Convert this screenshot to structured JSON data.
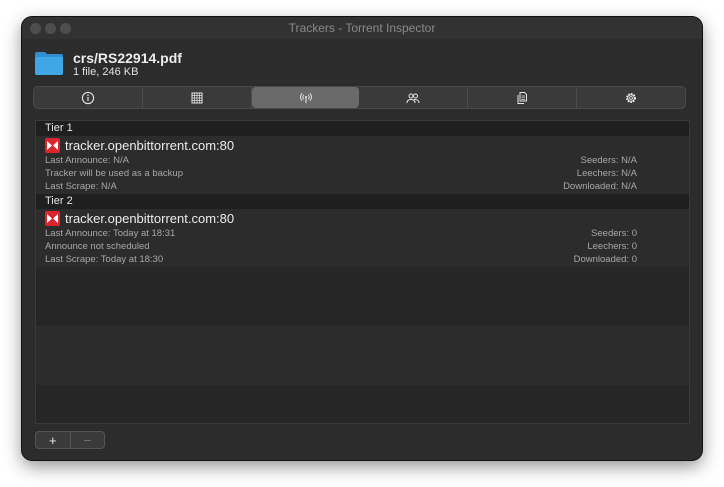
{
  "window": {
    "title": "Trackers - Torrent Inspector"
  },
  "header": {
    "name": "crs/RS22914.pdf",
    "info": "1 file, 246 KB"
  },
  "tabs": [
    {
      "icon": "info-icon",
      "active": false
    },
    {
      "icon": "grid-icon",
      "active": false
    },
    {
      "icon": "antenna-icon",
      "active": true
    },
    {
      "icon": "people-icon",
      "active": false
    },
    {
      "icon": "files-icon",
      "active": false
    },
    {
      "icon": "gear-icon",
      "active": false
    }
  ],
  "tiers": [
    {
      "label": "Tier 1",
      "tracker": {
        "name": "tracker.openbittorrent.com:80",
        "lines": [
          "Last Announce: N/A",
          "Tracker will be used as a backup",
          "Last Scrape: N/A"
        ],
        "stats": [
          "Seeders: N/A",
          "Leechers: N/A",
          "Downloaded: N/A"
        ]
      }
    },
    {
      "label": "Tier 2",
      "tracker": {
        "name": "tracker.openbittorrent.com:80",
        "lines": [
          "Last Announce: Today at 18:31",
          "Announce not scheduled",
          "Last Scrape: Today at 18:30"
        ],
        "stats": [
          "Seeders: 0",
          "Leechers: 0",
          "Downloaded: 0"
        ]
      }
    }
  ],
  "controls": {
    "add": "+",
    "remove": "−"
  },
  "colors": {
    "tracker_icon_red": "#d9262c",
    "folder_blue": "#3fa7e6"
  }
}
